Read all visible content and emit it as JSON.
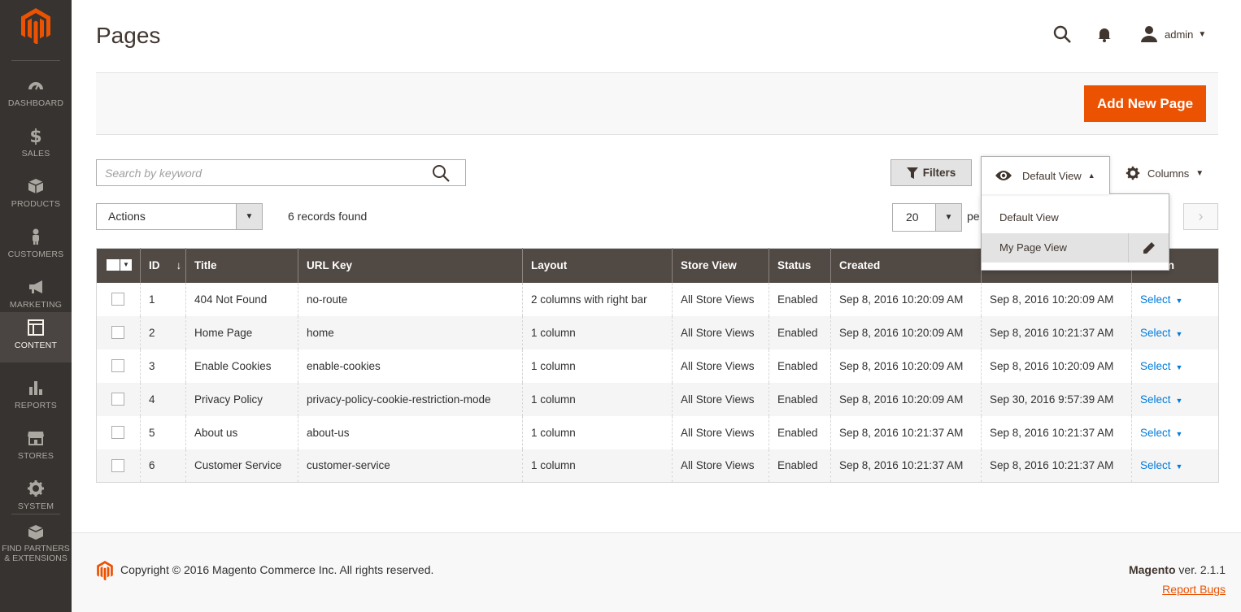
{
  "brand": {
    "accent": "#eb5202",
    "sidebar_bg": "#373330",
    "header_bg": "#514943",
    "link": "#007bdb"
  },
  "sidebar": {
    "items": [
      {
        "label": "Dashboard",
        "icon": "dashboard-icon"
      },
      {
        "label": "Sales",
        "icon": "dollar-icon"
      },
      {
        "label": "Products",
        "icon": "box-icon"
      },
      {
        "label": "Customers",
        "icon": "person-icon"
      },
      {
        "label": "Marketing",
        "icon": "megaphone-icon"
      },
      {
        "label": "Content",
        "icon": "layout-icon",
        "active": true
      },
      {
        "label": "Reports",
        "icon": "bar-chart-icon"
      },
      {
        "label": "Stores",
        "icon": "store-icon"
      },
      {
        "label": "System",
        "icon": "gear-icon"
      }
    ],
    "partners_line1": "Find Partners",
    "partners_line2": "& Extensions"
  },
  "header": {
    "title": "Pages",
    "user": "admin"
  },
  "action_bar": {
    "add_label": "Add New Page"
  },
  "toolbar": {
    "search_placeholder": "Search by keyword",
    "filters_label": "Filters",
    "view_label": "Default View",
    "view_options": [
      "Default View",
      "My Page View"
    ],
    "columns_label": "Columns",
    "actions_label": "Actions",
    "records_found": "6 records found",
    "per_page": "20",
    "per_page_label": "pe"
  },
  "grid": {
    "columns": [
      "ID",
      "Title",
      "URL Key",
      "Layout",
      "Store View",
      "Status",
      "Created",
      "",
      "Action"
    ],
    "sort_arrow": "↓",
    "rows": [
      {
        "id": "1",
        "title": "404 Not Found",
        "url_key": "no-route",
        "layout": "2 columns with right bar",
        "store_view": "All Store Views",
        "status": "Enabled",
        "created": "Sep 8, 2016 10:20:09 AM",
        "modified": "Sep 8, 2016 10:20:09 AM",
        "action": "Select"
      },
      {
        "id": "2",
        "title": "Home Page",
        "url_key": "home",
        "layout": "1 column",
        "store_view": "All Store Views",
        "status": "Enabled",
        "created": "Sep 8, 2016 10:20:09 AM",
        "modified": "Sep 8, 2016 10:21:37 AM",
        "action": "Select"
      },
      {
        "id": "3",
        "title": "Enable Cookies",
        "url_key": "enable-cookies",
        "layout": "1 column",
        "store_view": "All Store Views",
        "status": "Enabled",
        "created": "Sep 8, 2016 10:20:09 AM",
        "modified": "Sep 8, 2016 10:20:09 AM",
        "action": "Select"
      },
      {
        "id": "4",
        "title": "Privacy Policy",
        "url_key": "privacy-policy-cookie-restriction-mode",
        "layout": "1 column",
        "store_view": "All Store Views",
        "status": "Enabled",
        "created": "Sep 8, 2016 10:20:09 AM",
        "modified": "Sep 30, 2016 9:57:39 AM",
        "action": "Select"
      },
      {
        "id": "5",
        "title": "About us",
        "url_key": "about-us",
        "layout": "1 column",
        "store_view": "All Store Views",
        "status": "Enabled",
        "created": "Sep 8, 2016 10:21:37 AM",
        "modified": "Sep 8, 2016 10:21:37 AM",
        "action": "Select"
      },
      {
        "id": "6",
        "title": "Customer Service",
        "url_key": "customer-service",
        "layout": "1 column",
        "store_view": "All Store Views",
        "status": "Enabled",
        "created": "Sep 8, 2016 10:21:37 AM",
        "modified": "Sep 8, 2016 10:21:37 AM",
        "action": "Select"
      }
    ]
  },
  "footer": {
    "copyright": "Copyright © 2016 Magento Commerce Inc. All rights reserved.",
    "brand_name": "Magento",
    "version": "ver. 2.1.1",
    "report_bugs": "Report Bugs"
  }
}
